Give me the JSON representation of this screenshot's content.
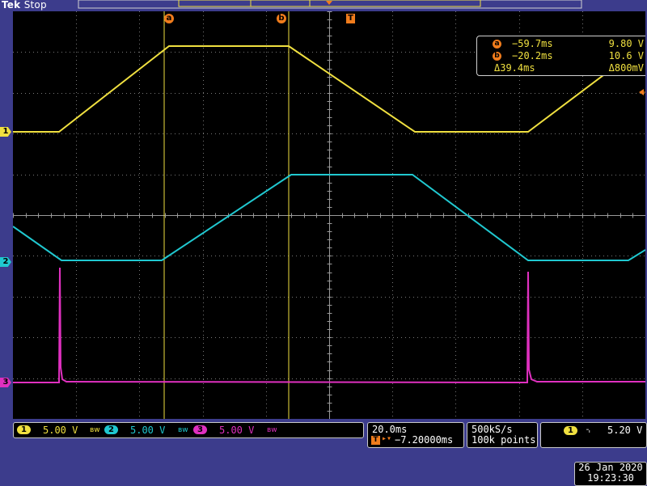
{
  "status": {
    "brand": "Tek",
    "state": "Stop"
  },
  "colors": {
    "ch1": "#f0e040",
    "ch2": "#20c8d0",
    "ch3": "#e030c0",
    "cursor": "#f07c1c",
    "grid": "#7a7a7a"
  },
  "markers": {
    "ch1": "1",
    "ch2": "2",
    "ch3": "3",
    "cursor_a": "a",
    "cursor_b": "b",
    "trigger": "T"
  },
  "readout": {
    "a_time": "−59.7ms",
    "a_volt": "9.80 V",
    "b_time": "−20.2ms",
    "b_volt": "10.6 V",
    "delta_time": "Δ39.4ms",
    "delta_volt": "Δ800mV"
  },
  "channels": [
    {
      "num": "1",
      "scale": "5.00 V",
      "bw_icon": "bandwidth-limit-icon",
      "bw_text": "ʙw"
    },
    {
      "num": "2",
      "scale": "5.00 V",
      "bw_icon": "bandwidth-limit-icon",
      "bw_text": "ʙw"
    },
    {
      "num": "3",
      "scale": "5.00 V",
      "bw_icon": "bandwidth-limit-icon",
      "bw_text": "ʙw"
    }
  ],
  "timebase": {
    "scale": "20.0ms",
    "position_icon": "trigger-position-icon",
    "position": "−7.20000ms"
  },
  "acquisition": {
    "sample_rate": "500kS/s",
    "record_length": "100k points"
  },
  "trigger": {
    "source": "1",
    "slope_icon": "falling-edge-icon",
    "slope_glyph": "⌍",
    "level": "5.20 V"
  },
  "datetime": {
    "date": "26 Jan  2020",
    "time": "19:23:30"
  }
}
